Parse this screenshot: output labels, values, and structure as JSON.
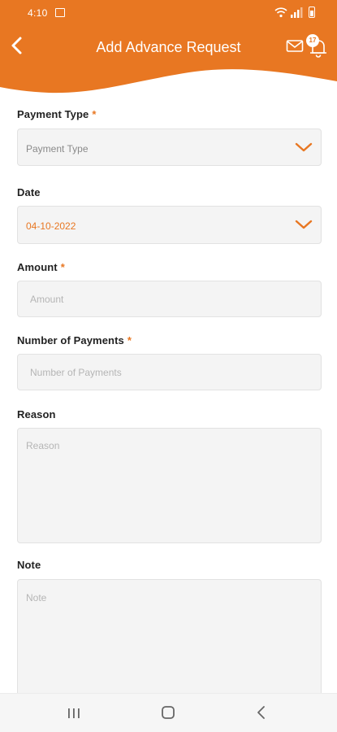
{
  "status_bar": {
    "time": "4:10"
  },
  "header": {
    "title": "Add Advance Request",
    "notification_count": "17",
    "accent_color": "#e87722",
    "icons": [
      "back-arrow-icon",
      "mail-icon",
      "bell-icon"
    ]
  },
  "form": {
    "payment_type": {
      "label": "Payment Type",
      "required": "*",
      "value": "Payment Type"
    },
    "date": {
      "label": "Date",
      "value": "04-10-2022"
    },
    "amount": {
      "label": "Amount",
      "required": "*",
      "placeholder": "Amount"
    },
    "number_of_payments": {
      "label": "Number of Payments",
      "required": "*",
      "placeholder": "Number of Payments"
    },
    "reason": {
      "label": "Reason",
      "placeholder": "Reason"
    },
    "note": {
      "label": "Note",
      "placeholder": "Note"
    }
  },
  "nav_bar": {
    "icons": [
      "recent-apps-icon",
      "home-icon",
      "back-icon"
    ]
  }
}
